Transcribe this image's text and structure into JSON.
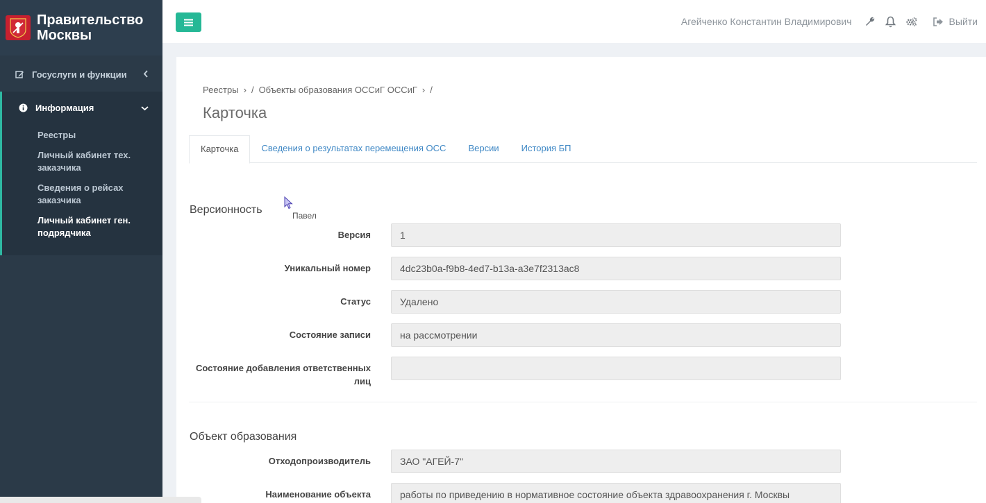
{
  "brand": {
    "title_line1": "Правительство",
    "title_line2": "Москвы"
  },
  "sidebar": {
    "services": {
      "label": "Госуслуги и функции"
    },
    "info": {
      "label": "Информация"
    },
    "sub_items": [
      {
        "label": "Реестры"
      },
      {
        "label": "Личный кабинет тех. заказчика"
      },
      {
        "label": "Сведения о рейсах заказчика"
      },
      {
        "label": "Личный кабинет ген. подрядчика"
      }
    ]
  },
  "topbar": {
    "user_name": "Агейченко Константин Владимирович",
    "logout_label": "Выйти"
  },
  "breadcrumb": [
    "Реестры",
    "›",
    "/",
    "Объекты образования ОССиГ ОССиГ",
    "›",
    "/"
  ],
  "page_title": "Карточка",
  "tabs": [
    {
      "label": "Карточка",
      "active": true
    },
    {
      "label": "Сведения о результатах перемещения ОСС"
    },
    {
      "label": "Версии"
    },
    {
      "label": "История БП"
    }
  ],
  "versioning": {
    "title": "Версионность",
    "fields": [
      {
        "label": "Версия",
        "value": "1"
      },
      {
        "label": "Уникальный номер",
        "value": "4dc23b0a-f9b8-4ed7-b13a-a3e7f2313ac8"
      },
      {
        "label": "Статус",
        "value": "Удалено"
      },
      {
        "label": "Состояние записи",
        "value": "на рассмотрении"
      },
      {
        "label": "Состояние добавления ответственных лиц",
        "value": ""
      }
    ]
  },
  "object": {
    "title": "Объект образования",
    "fields": [
      {
        "label": "Отходопроизводитель",
        "value": "ЗАО \"АГЕЙ-7\""
      },
      {
        "label": "Наименование объекта",
        "value": "работы по приведению в нормативное состояние объекта здравоохранения г. Москвы"
      }
    ]
  },
  "cursor_label": "Павел",
  "colors": {
    "sidebar": "#2b3a48",
    "accent": "#25b896",
    "link": "#3f88c5",
    "brand_red": "#c8202f"
  }
}
